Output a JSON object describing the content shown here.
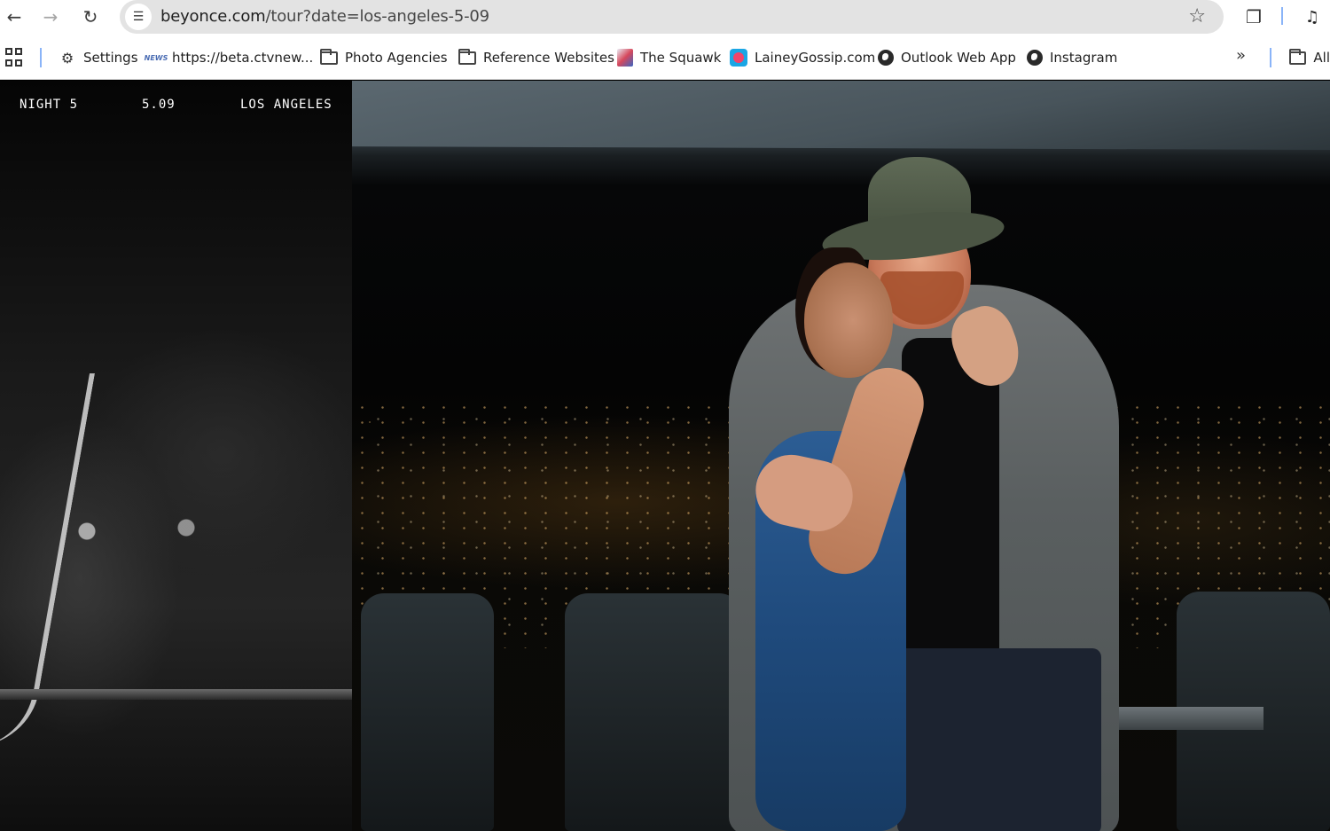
{
  "browser": {
    "url_domain": "beyonce.com",
    "url_path": "/tour?date=los-angeles-5-09",
    "icons": {
      "back": "arrow-left-icon",
      "forward": "arrow-right-icon",
      "reload": "reload-icon",
      "site_info": "tune-icon",
      "bookmark_star": "star-icon",
      "extensions": "puzzle-icon",
      "media": "queue-music-icon"
    }
  },
  "bookmarks": {
    "items": [
      {
        "label": "Settings",
        "icon": "gear-icon"
      },
      {
        "label": "https://beta.ctvnew...",
        "icon": "ctv-news-icon"
      },
      {
        "label": "Photo Agencies",
        "icon": "folder-icon"
      },
      {
        "label": "Reference Websites",
        "icon": "folder-icon"
      },
      {
        "label": "The Squawk",
        "icon": "squawk-icon"
      },
      {
        "label": "LaineyGossip.com",
        "icon": "lainey-icon"
      },
      {
        "label": "Outlook Web App",
        "icon": "globe-icon"
      },
      {
        "label": "Instagram",
        "icon": "globe-icon"
      }
    ],
    "overflow_label": "»",
    "all_bookmarks_label": "All"
  },
  "page": {
    "night": "NIGHT 5",
    "date": "5.09",
    "city": "LOS ANGELES"
  },
  "colors": {
    "omnibox_bg": "#e3e3e3",
    "toolbar_bg": "#ffffff",
    "separator": "#8ab4f8",
    "page_bg": "#000000",
    "dress": "#1f4a7c"
  }
}
